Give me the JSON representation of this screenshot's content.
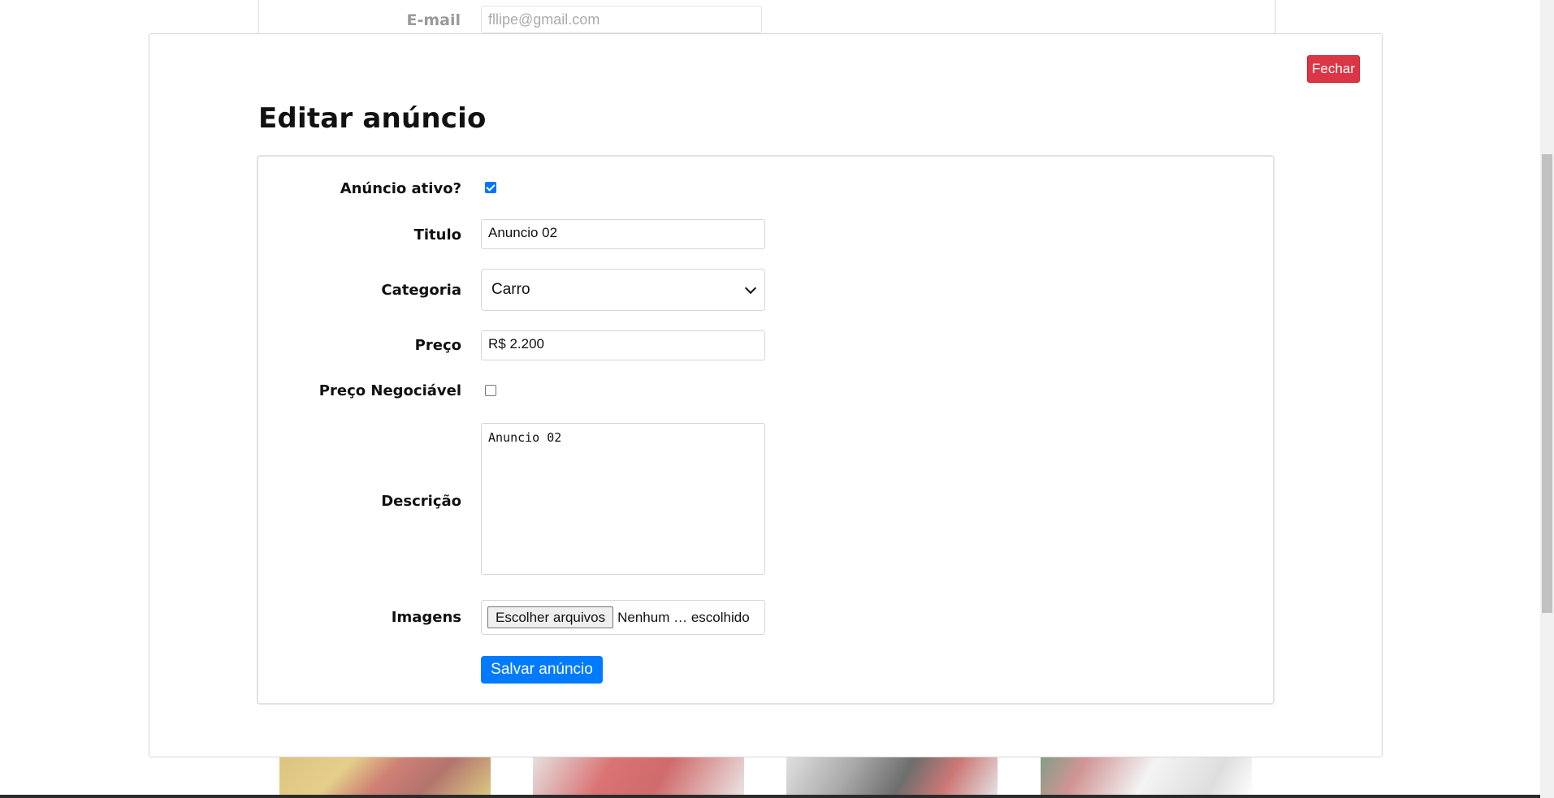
{
  "background": {
    "email_label": "E-mail",
    "email_value": "fllipe@gmail.com"
  },
  "modal": {
    "close_label": "Fechar",
    "title": "Editar anúncio"
  },
  "form": {
    "active_label": "Anúncio ativo?",
    "active_checked": true,
    "title_label": "Titulo",
    "title_value": "Anuncio 02",
    "category_label": "Categoria",
    "category_value": "Carro",
    "price_label": "Preço",
    "price_value": "R$ 2.200",
    "negotiable_label": "Preço Negociável",
    "negotiable_checked": false,
    "description_label": "Descrição",
    "description_value": "Anuncio 02",
    "images_label": "Imagens",
    "file_button_label": "Escolher arquivos",
    "file_status": "Nenhum … escolhido",
    "save_label": "Salvar anúncio"
  },
  "colors": {
    "close_button": "#dc3545",
    "save_button": "#007bff",
    "checkbox_checked": "#0075ff"
  }
}
